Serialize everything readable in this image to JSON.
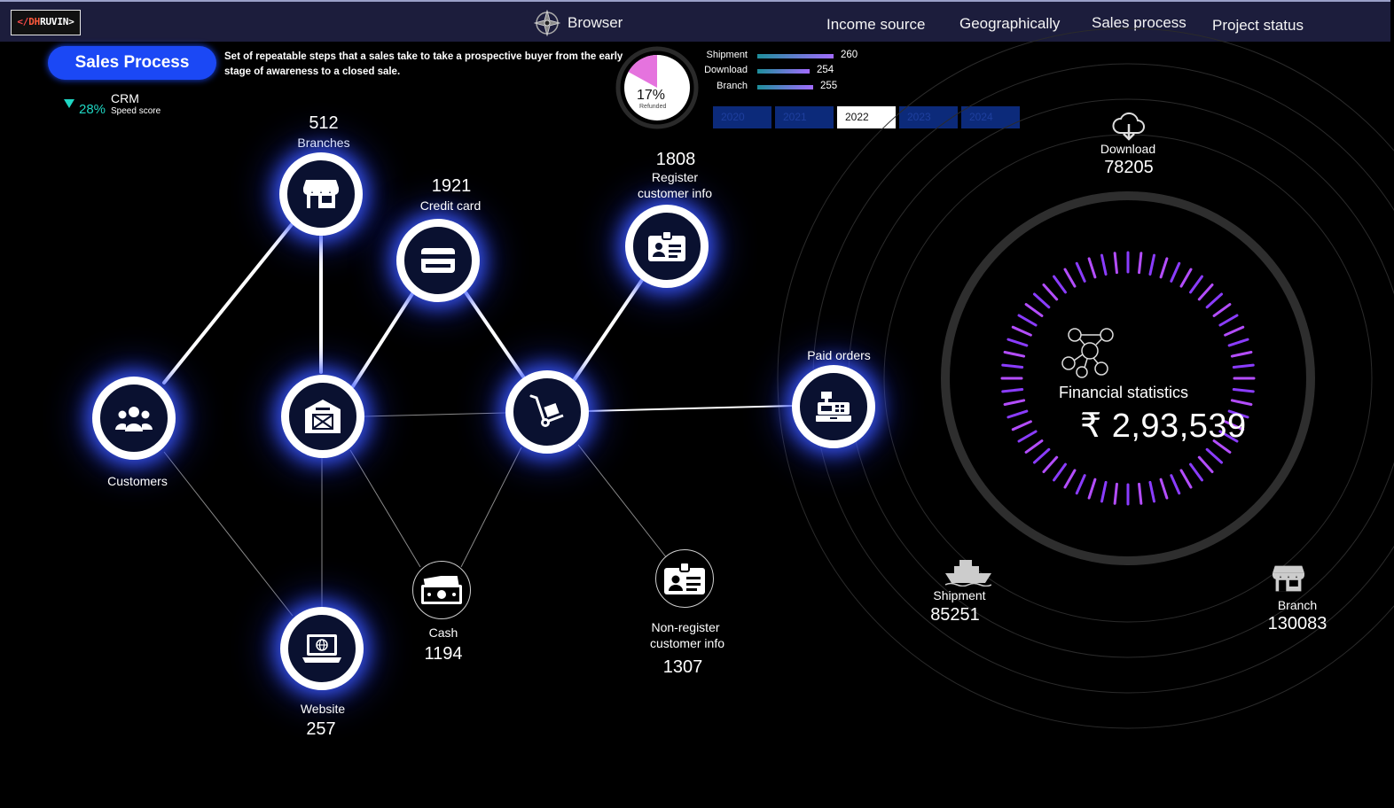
{
  "header": {
    "logo": {
      "bracket": "</",
      "brand_a": "DH",
      "brand_b": "RUVIN>"
    },
    "browser_label": "Browser",
    "nav": [
      "Income source",
      "Geographically",
      "Sales process",
      "Project status"
    ]
  },
  "sales_process": {
    "button_label": "Sales Process",
    "description": "Set of repeatable steps that a sales take to take a prospective buyer from the early stage of awareness to a closed sale.",
    "crm": {
      "percent": "28%",
      "label": "CRM",
      "sublabel": "Speed score",
      "trend": "down",
      "trend_color": "#1fd6c3"
    }
  },
  "refund_donut": {
    "percent_label": "17%",
    "sublabel": "Refunded",
    "fraction": 0.17,
    "color": "#e05ad8"
  },
  "mini_bars": [
    {
      "label": "Shipment",
      "value": 260
    },
    {
      "label": "Download",
      "value": 254
    },
    {
      "label": "Branch",
      "value": 255
    }
  ],
  "years": {
    "options": [
      "2020",
      "2021",
      "2022",
      "2023",
      "2024"
    ],
    "selected": "2022"
  },
  "nodes": {
    "branches": {
      "value": "512",
      "label": "Branches",
      "icon": "store-icon"
    },
    "credit_card": {
      "value": "1921",
      "label": "Credit card",
      "icon": "credit-card-icon"
    },
    "register": {
      "value": "1808",
      "label_line1": "Register",
      "label_line2": "customer info",
      "icon": "id-card-icon"
    },
    "customers": {
      "label": "Customers",
      "icon": "users-icon"
    },
    "warehouse": {
      "icon": "warehouse-icon"
    },
    "delivery": {
      "icon": "hand-truck-icon"
    },
    "paid_orders": {
      "label": "Paid orders",
      "icon": "cash-register-icon"
    },
    "website": {
      "value": "257",
      "label": "Website",
      "icon": "laptop-icon"
    },
    "cash": {
      "value": "1194",
      "label": "Cash",
      "icon": "cash-icon"
    },
    "non_register": {
      "value": "1307",
      "label_line1": "Non-register",
      "label_line2": "customer info",
      "icon": "id-card-icon"
    }
  },
  "financial": {
    "title": "Financial statistics",
    "value": "₹ 2,93,539",
    "icon": "network-people-icon",
    "download": {
      "label": "Download",
      "value": "78205",
      "icon": "cloud-download-icon"
    },
    "shipment": {
      "label": "Shipment",
      "value": "85251",
      "icon": "ship-icon"
    },
    "branch": {
      "label": "Branch",
      "value": "130083",
      "icon": "store-icon"
    }
  },
  "colors": {
    "accent": "#1b48f5",
    "topbar": "#1c1d3c",
    "tick_gradient": [
      "#7a3cff",
      "#ff5ad8"
    ]
  }
}
